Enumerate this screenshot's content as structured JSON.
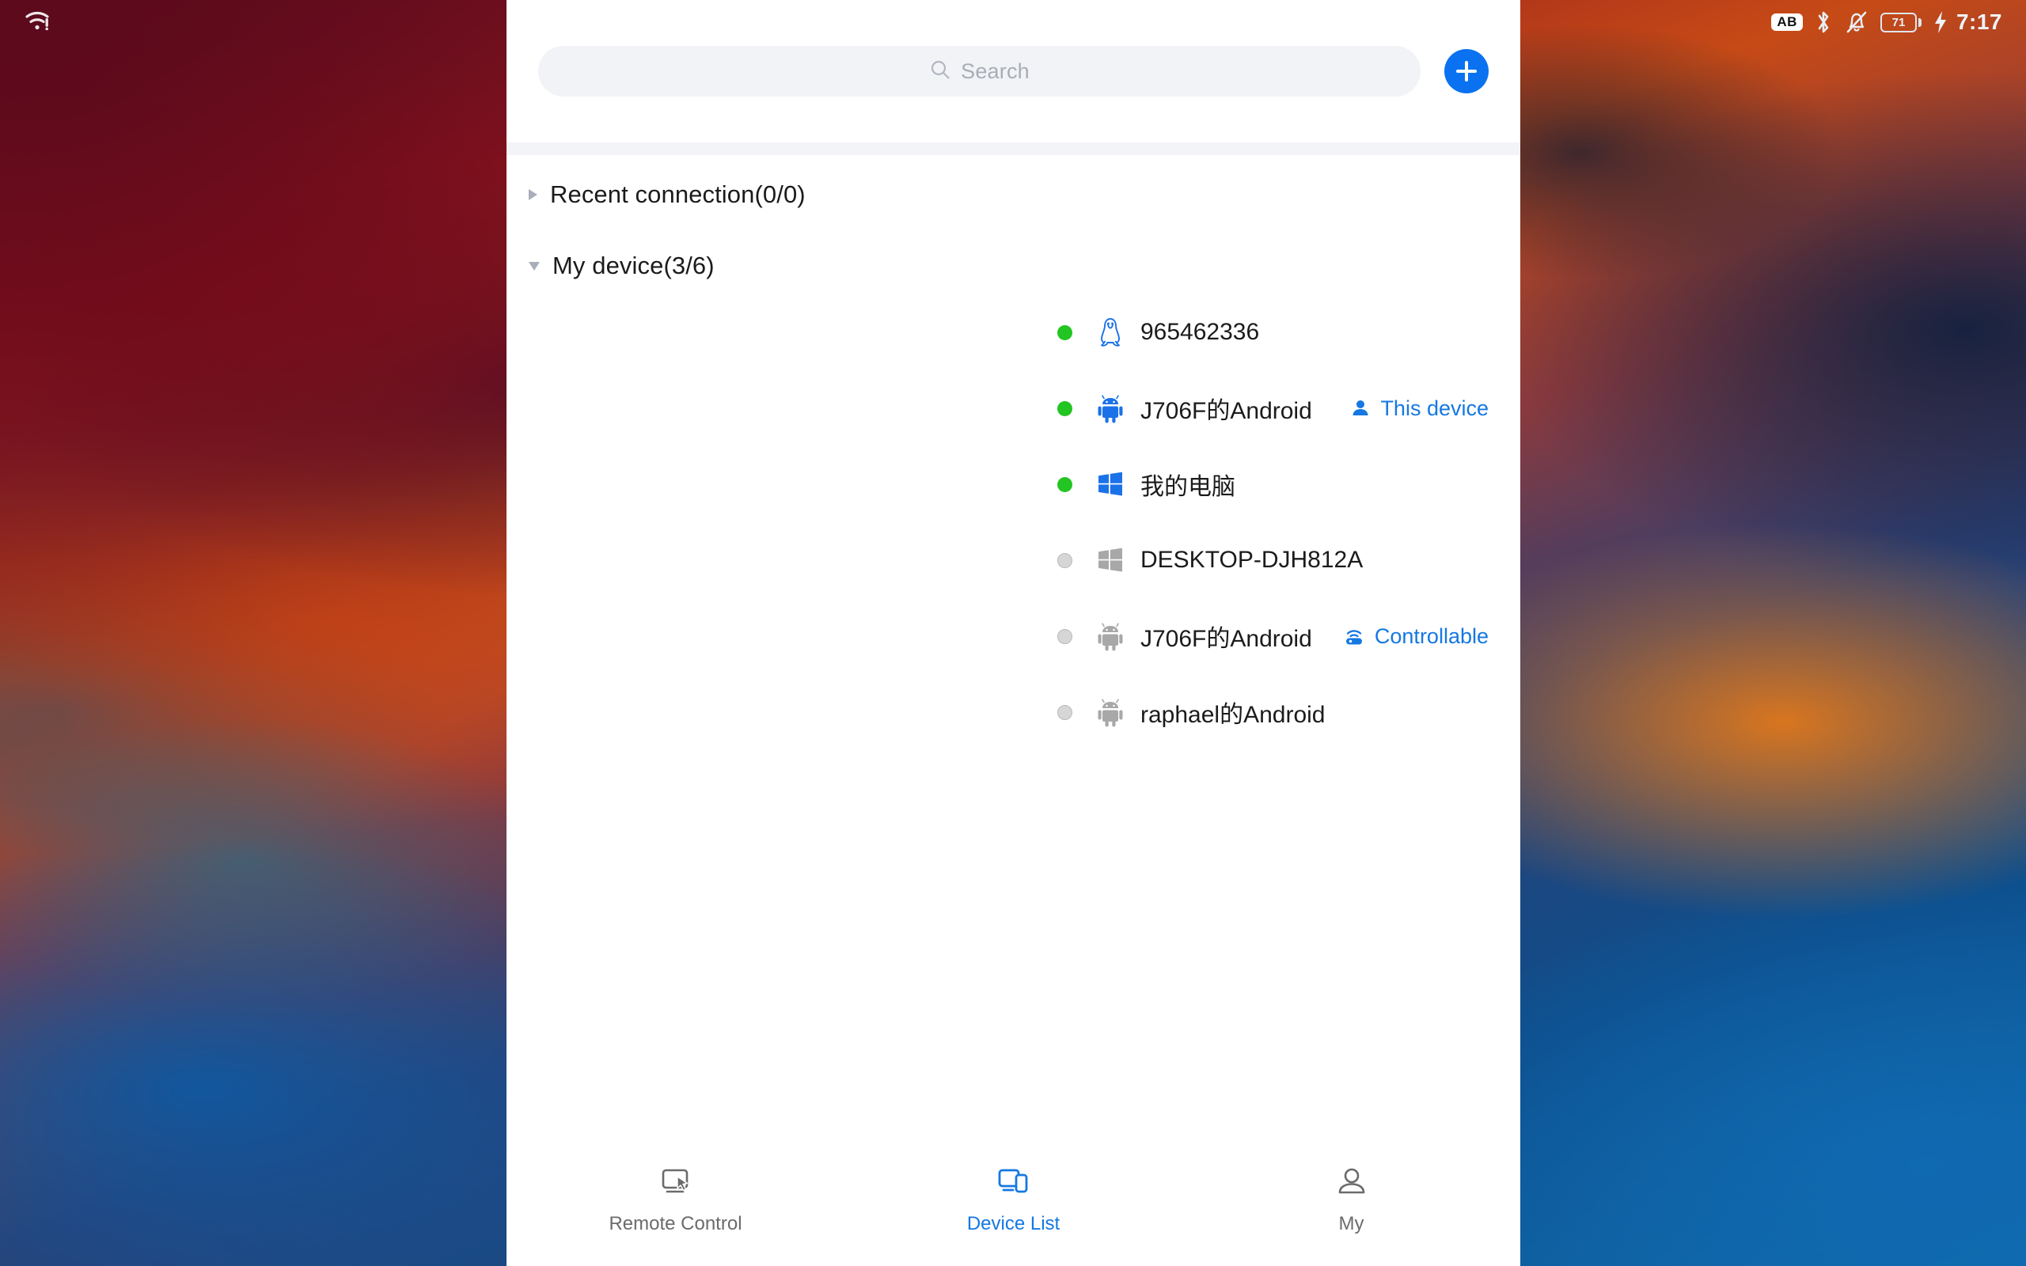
{
  "statusbar": {
    "wifi_icon": "wifi-icon",
    "input_badge": "AB",
    "bluetooth_icon": "bluetooth-icon",
    "mute_icon": "notifications-muted-icon",
    "battery_level": "71",
    "charging_icon": "charging-bolt-icon",
    "time": "7:17"
  },
  "header": {
    "search": {
      "placeholder": "Search",
      "value": "",
      "icon": "search-icon"
    },
    "add_button": {
      "icon": "plus-icon",
      "label": "+"
    }
  },
  "groups": [
    {
      "title": "Recent connection(0/0)",
      "expanded": false,
      "caret": "chevron-right-icon",
      "devices": []
    },
    {
      "title": "My device(3/6)",
      "expanded": true,
      "caret": "chevron-down-icon",
      "devices": [
        {
          "name": "965462336",
          "status": "online",
          "platform_icon": "penguin-icon",
          "tag": null,
          "tag_icon": null
        },
        {
          "name": "J706F的Android",
          "status": "online",
          "platform_icon": "android-icon",
          "tag": "This device",
          "tag_icon": "person-icon"
        },
        {
          "name": "我的电脑",
          "status": "online",
          "platform_icon": "windows-icon",
          "tag": null,
          "tag_icon": null
        },
        {
          "name": "DESKTOP-DJH812A",
          "status": "offline",
          "platform_icon": "windows-icon",
          "tag": null,
          "tag_icon": null
        },
        {
          "name": "J706F的Android",
          "status": "offline",
          "platform_icon": "android-icon",
          "tag": "Controllable",
          "tag_icon": "broadcast-icon"
        },
        {
          "name": "raphael的Android",
          "status": "offline",
          "platform_icon": "android-icon",
          "tag": null,
          "tag_icon": null
        }
      ]
    }
  ],
  "bottom_nav": {
    "items": [
      {
        "label": "Remote Control",
        "icon": "monitor-cursor-icon",
        "active": false
      },
      {
        "label": "Device List",
        "icon": "devices-icon",
        "active": true
      },
      {
        "label": "My",
        "icon": "person-outline-icon",
        "active": false
      }
    ]
  },
  "colors": {
    "accent": "#1578e2",
    "add_button": "#0a72f0",
    "online_dot": "#22c522",
    "offline_dot": "#d6d6d6",
    "panel_bg": "#ffffff",
    "search_bg": "#f1f3f7",
    "text_primary": "#1b1b1b",
    "text_muted": "#6b6b6b"
  }
}
